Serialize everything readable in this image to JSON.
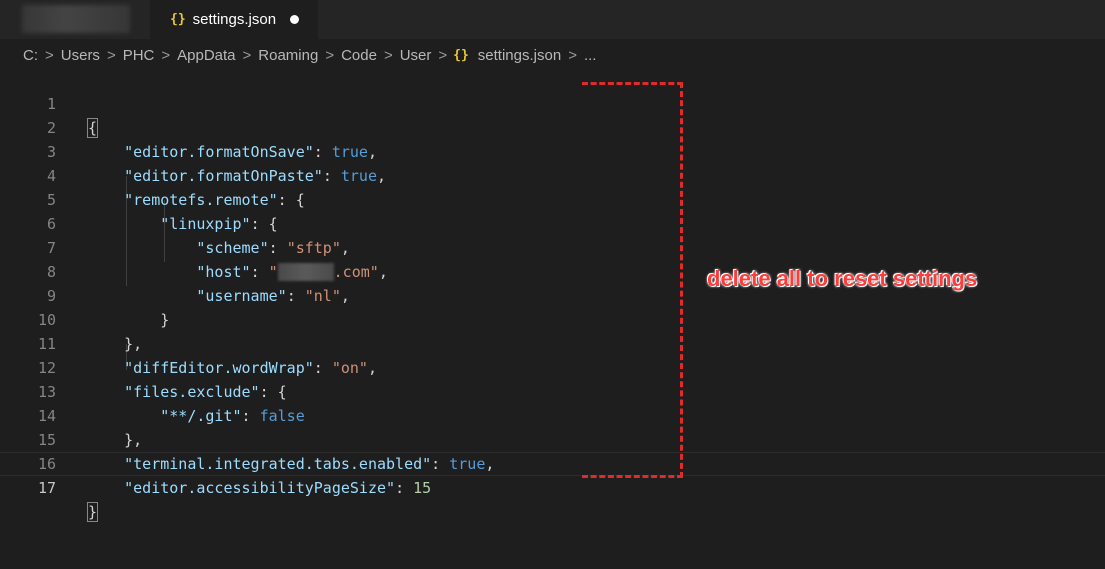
{
  "tabs": {
    "active": {
      "icon": "json-braces-icon",
      "icon_glyph": "{}",
      "label": "settings.json",
      "dirty": true
    }
  },
  "breadcrumb": {
    "items": [
      "C:",
      "Users",
      "PHC",
      "AppData",
      "Roaming",
      "Code",
      "User"
    ],
    "file_icon": "{}",
    "file": "settings.json",
    "more": "...",
    "separator": ">"
  },
  "editor": {
    "line_numbers": [
      "1",
      "2",
      "3",
      "4",
      "5",
      "6",
      "7",
      "8",
      "9",
      "10",
      "11",
      "12",
      "13",
      "14",
      "15",
      "16",
      "17"
    ],
    "current_line": 17,
    "tokens": {
      "l1": "{",
      "l2_key": "\"editor.formatOnSave\"",
      "l2_val": "true",
      "l3_key": "\"editor.formatOnPaste\"",
      "l3_val": "true",
      "l4_key": "\"remotefs.remote\"",
      "l4_open": "{",
      "l5_key": "\"linuxpip\"",
      "l5_open": "{",
      "l6_key": "\"scheme\"",
      "l6_val": "\"sftp\"",
      "l7_key": "\"host\"",
      "l7_val_start": "\"",
      "l7_val_end": ".com\"",
      "l8_key": "\"username\"",
      "l8_val": "\"nl\"",
      "l9": "}",
      "l10": "},",
      "l11_key": "\"diffEditor.wordWrap\"",
      "l11_val": "\"on\"",
      "l12_key": "\"files.exclude\"",
      "l12_open": "{",
      "l13_key": "\"**/.git\"",
      "l13_val": "false",
      "l14": "},",
      "l15_key": "\"terminal.integrated.tabs.enabled\"",
      "l15_val": "true",
      "l16_key": "\"editor.accessibilityPageSize\"",
      "l16_val": "15",
      "l17": "}"
    }
  },
  "annotation": {
    "text": "delete all to reset settings",
    "color": "#e02b2b"
  },
  "colors": {
    "editor_bg": "#1e1e1e",
    "key": "#9cdcfe",
    "string": "#ce9178",
    "boolean": "#569cd6",
    "number": "#b5cea8",
    "json_icon": "#e8c63a"
  }
}
